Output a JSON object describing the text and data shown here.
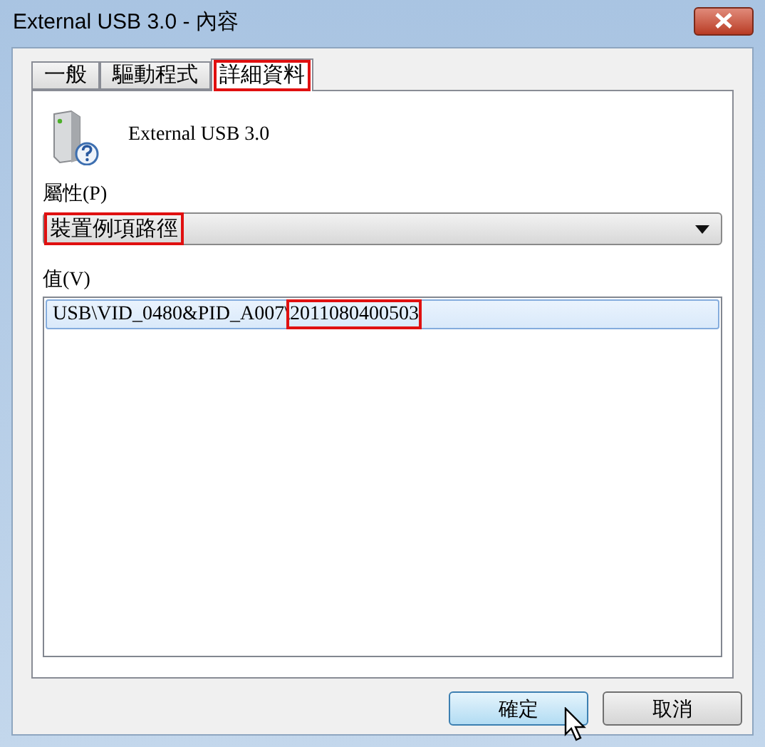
{
  "window": {
    "title": "External USB 3.0 - 內容"
  },
  "tabs": [
    {
      "label": "一般",
      "selected": false,
      "highlighted": false
    },
    {
      "label": "驅動程式",
      "selected": false,
      "highlighted": false
    },
    {
      "label": "詳細資料",
      "selected": true,
      "highlighted": true
    }
  ],
  "device": {
    "name": "External USB 3.0"
  },
  "property": {
    "label": "屬性(P)",
    "value": "裝置例項路徑",
    "highlighted": true
  },
  "value": {
    "label": "值(V)",
    "rows": [
      {
        "selected": true,
        "segments": [
          {
            "text": "USB\\VID_0480&PID_A007\\",
            "highlighted": false
          },
          {
            "text": "2011080400503",
            "highlighted": true
          }
        ]
      }
    ]
  },
  "buttons": [
    {
      "label": "確定",
      "default": true
    },
    {
      "label": "取消",
      "default": false
    }
  ]
}
